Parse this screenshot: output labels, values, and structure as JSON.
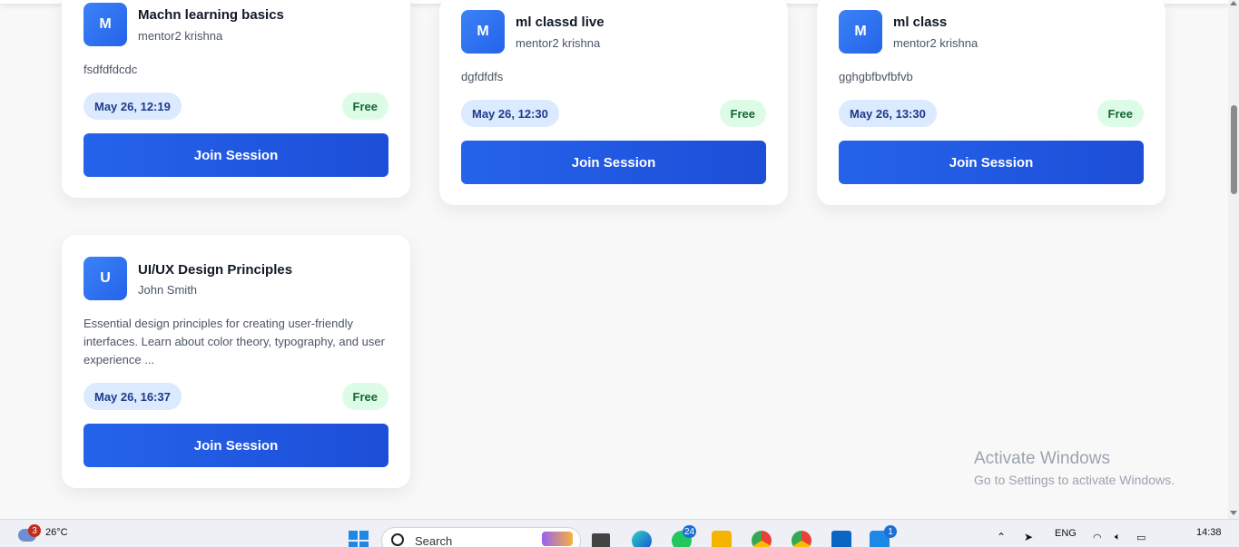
{
  "sessions": [
    {
      "initial": "M",
      "title": "Machn learning basics",
      "mentor": "mentor2 krishna",
      "description": "fsdfdfdcdc",
      "date": "May 26, 12:19",
      "price": "Free",
      "join_label": "Join Session"
    },
    {
      "initial": "M",
      "title": "ml classd live",
      "mentor": "mentor2 krishna",
      "description": "dgfdfdfs",
      "date": "May 26, 12:30",
      "price": "Free",
      "join_label": "Join Session"
    },
    {
      "initial": "M",
      "title": "ml class",
      "mentor": "mentor2 krishna",
      "description": "gghgbfbvfbfvb",
      "date": "May 26, 13:30",
      "price": "Free",
      "join_label": "Join Session"
    },
    {
      "initial": "U",
      "title": "UI/UX Design Principles",
      "mentor": "John Smith",
      "description": "Essential design principles for creating user-friendly interfaces. Learn about color theory, typography, and user experience ...",
      "date": "May 26, 16:37",
      "price": "Free",
      "join_label": "Join Session"
    }
  ],
  "watermark": {
    "line1": "Activate Windows",
    "line2": "Go to Settings to activate Windows."
  },
  "taskbar": {
    "weather_badge": "3",
    "temperature": "26°C",
    "search_placeholder": "Search",
    "whatsapp_badge": "24",
    "store_badge": "1",
    "language": "ENG",
    "time": "14:38"
  },
  "colors": {
    "accent": "#2563eb",
    "date_pill_bg": "#dbeafe",
    "free_pill_bg": "#dcfce7",
    "free_text": "#166534"
  }
}
